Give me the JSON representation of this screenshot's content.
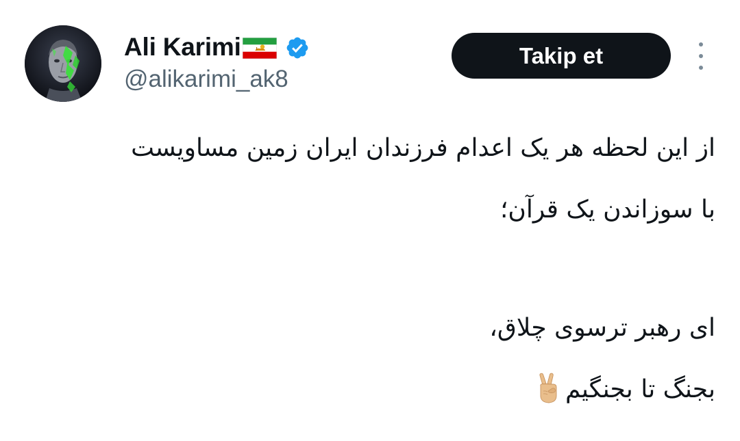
{
  "author": {
    "display_name": "Ali Karimi",
    "handle": "@alikarimi_ak8",
    "verified": true,
    "flag_emoji": "Iran (Lion and Sun) flag",
    "avatar": "avatar-portrait-icon"
  },
  "actions": {
    "follow_label": "Takip et",
    "more_icon": "more-vertical-icon"
  },
  "tweet": {
    "lines": [
      "از این لحظه هر یک اعدام فرزندان ایران زمین مساویست",
      "با سوزاندن یک قرآن؛",
      "",
      "ای رهبر ترسوی چلاق،",
      "بجنگ تا بجنگیم"
    ],
    "trailing_emoji": "victory-hand-icon"
  },
  "colors": {
    "text_primary": "#0f1419",
    "text_secondary": "#536471",
    "button_bg": "#0f1419",
    "button_text": "#ffffff",
    "verified_blue": "#1d9bf0",
    "background": "#ffffff"
  }
}
